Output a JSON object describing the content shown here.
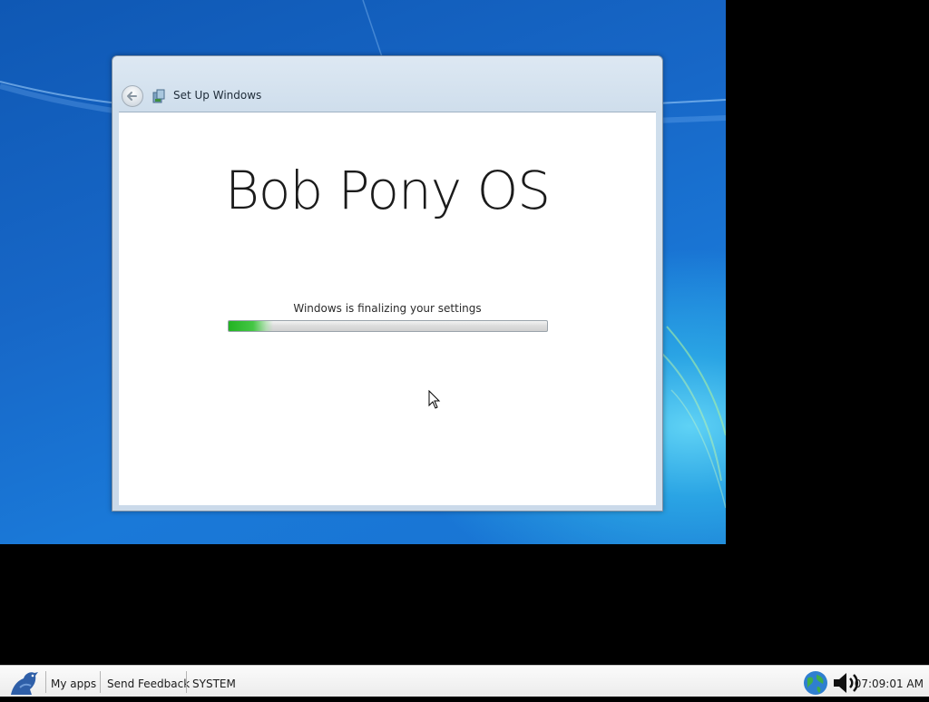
{
  "window": {
    "title": "Set Up Windows",
    "brand": "Bob Pony OS",
    "status": "Windows is finalizing your settings",
    "progress_fraction": 0.14
  },
  "taskbar": {
    "items": [
      "My apps",
      "Send Feedback",
      "SYSTEM"
    ],
    "clock": "07:09:01 AM"
  },
  "colors": {
    "desktop_blue": "#1767c7",
    "progress_green": "#2fbb2f",
    "taskbar_bg": "#f4f4f4"
  },
  "icons": {
    "start": "bird-logo-icon",
    "back": "back-arrow-icon",
    "setup": "setup-icon",
    "network": "globe-icon",
    "volume": "speaker-icon"
  }
}
